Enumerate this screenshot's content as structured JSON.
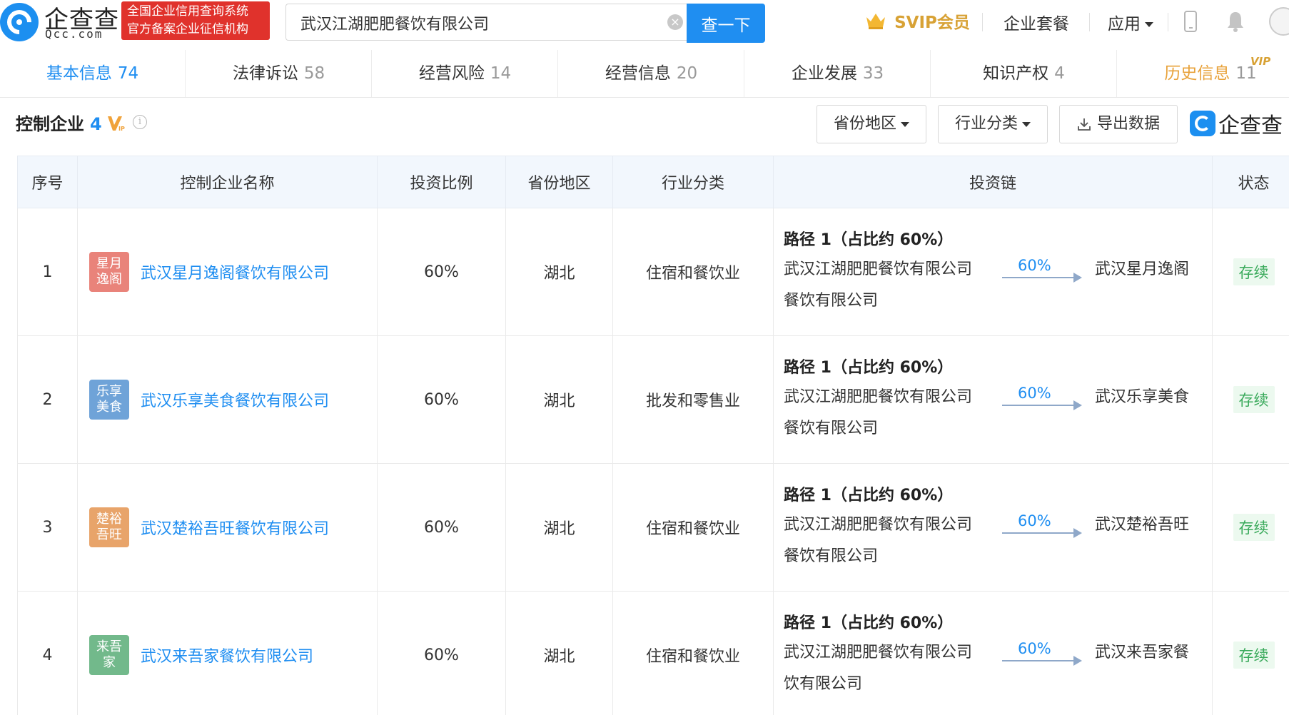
{
  "header": {
    "logo_name": "企查查",
    "logo_domain": "Qcc.com",
    "cert_line1": "全国企业信用查询系统",
    "cert_line2": "官方备案企业征信机构",
    "search_value": "武汉江湖肥肥餐饮有限公司",
    "search_button": "查一下",
    "clear_symbol": "×",
    "svip_label": "SVIP会员",
    "nav_package": "企业套餐",
    "nav_apps": "应用"
  },
  "tabs": [
    {
      "label": "基本信息",
      "count": "74"
    },
    {
      "label": "法律诉讼",
      "count": "58"
    },
    {
      "label": "经营风险",
      "count": "14"
    },
    {
      "label": "经营信息",
      "count": "20"
    },
    {
      "label": "企业发展",
      "count": "33"
    },
    {
      "label": "知识产权",
      "count": "4"
    },
    {
      "label": "历史信息",
      "count": "11",
      "badge": "VIP"
    }
  ],
  "section": {
    "title": "控制企业",
    "count": "4",
    "info_symbol": "i",
    "filter_region": "省份地区",
    "filter_industry": "行业分类",
    "export": "导出数据",
    "brand": "企查查"
  },
  "table": {
    "headers": [
      "序号",
      "控制企业名称",
      "投资比例",
      "省份地区",
      "行业分类",
      "投资链",
      "状态"
    ],
    "rows": [
      {
        "index": "1",
        "logo_line1": "星月",
        "logo_line2": "逸阁",
        "logo_color": "#e9837a",
        "name": "武汉星月逸阁餐饮有限公司",
        "ratio": "60%",
        "region": "湖北",
        "industry": "住宿和餐饮业",
        "path_title": "路径 1（占比约 60%）",
        "chain_source": "武汉江湖肥肥餐饮有限公司",
        "chain_pct": "60%",
        "chain_target_start": "武汉星月逸阁",
        "chain_target_rest": "餐饮有限公司",
        "status": "存续"
      },
      {
        "index": "2",
        "logo_line1": "乐享",
        "logo_line2": "美食",
        "logo_color": "#6fa3d8",
        "name": "武汉乐享美食餐饮有限公司",
        "ratio": "60%",
        "region": "湖北",
        "industry": "批发和零售业",
        "path_title": "路径 1（占比约 60%）",
        "chain_source": "武汉江湖肥肥餐饮有限公司",
        "chain_pct": "60%",
        "chain_target_start": "武汉乐享美食",
        "chain_target_rest": "餐饮有限公司",
        "status": "存续"
      },
      {
        "index": "3",
        "logo_line1": "楚裕",
        "logo_line2": "吾旺",
        "logo_color": "#e8a46a",
        "name": "武汉楚裕吾旺餐饮有限公司",
        "ratio": "60%",
        "region": "湖北",
        "industry": "住宿和餐饮业",
        "path_title": "路径 1（占比约 60%）",
        "chain_source": "武汉江湖肥肥餐饮有限公司",
        "chain_pct": "60%",
        "chain_target_start": "武汉楚裕吾旺",
        "chain_target_rest": "餐饮有限公司",
        "status": "存续"
      },
      {
        "index": "4",
        "logo_line1": "来吾",
        "logo_line2": "家",
        "logo_color": "#72b98b",
        "name": "武汉来吾家餐饮有限公司",
        "ratio": "60%",
        "region": "湖北",
        "industry": "住宿和餐饮业",
        "path_title": "路径 1（占比约 60%）",
        "chain_source": "武汉江湖肥肥餐饮有限公司",
        "chain_pct": "60%",
        "chain_target_start": "武汉来吾家餐",
        "chain_target_rest": "饮有限公司",
        "status": "存续"
      }
    ]
  },
  "icons": {
    "logo": "qcc-logo-icon",
    "clear": "clear-icon",
    "crown": "crown-icon",
    "phone": "phone-icon",
    "bell": "bell-icon",
    "vip": "vip-badge-icon",
    "info": "info-icon",
    "download": "download-icon"
  },
  "colors": {
    "accent": "#1f8ef1",
    "cert_red": "#e0322c",
    "svip_gold": "#d8a235",
    "status_green": "#3aaa5b"
  }
}
